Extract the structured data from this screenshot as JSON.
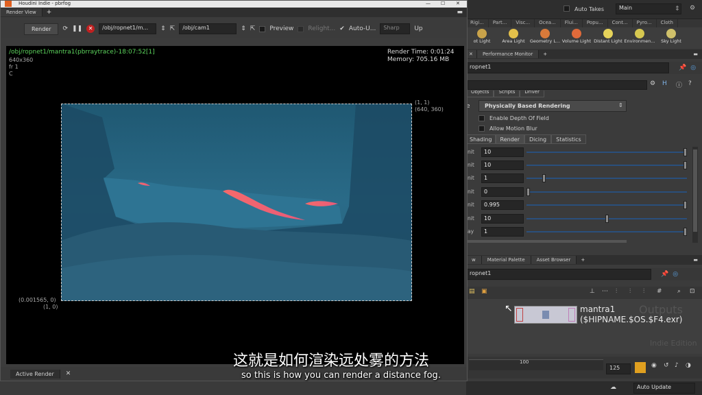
{
  "render_view": {
    "window_title": "Houdini Indie - pbrfog",
    "tab": "Render View",
    "render_button": "Render",
    "rop_path": "/obj/ropnet1/m...",
    "camera_path": "/obj/cam1",
    "preview_label": "Preview",
    "relight_label": "Relight...",
    "auto_update_label": "Auto-U...",
    "sharp_label": "Sharp",
    "up_label": "Up",
    "image_title": "/obj/ropnet1/mantra1(pbrraytrace)-18:07:52[1]",
    "resolution": "640x360",
    "frame": "fr 1",
    "channel": "C",
    "render_time": "Render Time: 0:01:24",
    "memory": "Memory:   705.16 MB",
    "coord_top_right_1": "(1, 1)",
    "coord_top_right_2": "(640, 360)",
    "coord_bottom_left_1": "(0.001565, 0)",
    "coord_bottom_left_2": "(1, 0)",
    "active_render": "Active Render"
  },
  "top": {
    "auto_takes": "Auto Takes",
    "main": "Main"
  },
  "shelf_tabs": [
    "Rigi...",
    "Part...",
    "Visc...",
    "Ocea...",
    "Flui...",
    "Popu...",
    "Cont...",
    "Pyro...",
    "Cloth"
  ],
  "shelf_tools": [
    {
      "label": "ot Light",
      "color": "#c9a34a"
    },
    {
      "label": "Area Light",
      "color": "#e3c04a"
    },
    {
      "label": "Geometry L...",
      "color": "#d97a3a"
    },
    {
      "label": "Volume Light",
      "color": "#e06a3a"
    },
    {
      "label": "Distant Light",
      "color": "#e6d35a"
    },
    {
      "label": "Environmen...",
      "color": "#d6c850"
    },
    {
      "label": "Sky Light",
      "color": "#cfc06a"
    }
  ],
  "params_panel": {
    "tabs": [
      "Performance Monitor"
    ],
    "node": "ropnet1",
    "subtabs": [
      "Objects",
      "Scripts",
      "Driver"
    ],
    "render_engine": "Physically Based Rendering",
    "enable_dof": "Enable Depth Of Field",
    "allow_motion_blur": "Allow Motion Blur",
    "render_tabs": [
      "Shading",
      "Render",
      "Dicing",
      "Statistics"
    ],
    "rows": [
      {
        "label": "nit",
        "value": "10",
        "fill": 1.0
      },
      {
        "label": "nit",
        "value": "10",
        "fill": 1.0
      },
      {
        "label": "nit",
        "value": "1",
        "fill": 0.1
      },
      {
        "label": "nit",
        "value": "0",
        "fill": 0.0
      },
      {
        "label": "nit",
        "value": "0.995",
        "fill": 1.0
      },
      {
        "label": "nit",
        "value": "10",
        "fill": 0.5
      },
      {
        "label": "ay",
        "value": "1",
        "fill": 1.0
      }
    ]
  },
  "network_panel": {
    "tabs": [
      "w",
      "Material Palette",
      "Asset Browser"
    ],
    "path": "ropnet1",
    "node_name": "mantra1",
    "node_output": "($HIPNAME.$OS.$F4.exr)",
    "watermark_outputs": "Outputs",
    "watermark_edition": "Indie Edition"
  },
  "timeline": {
    "mark": "100",
    "frame": "125",
    "auto_update": "Auto Update"
  },
  "subtitles": {
    "zh": "这就是如何渲染远处雾的方法",
    "en": "so this is how you can render a distance fog."
  }
}
